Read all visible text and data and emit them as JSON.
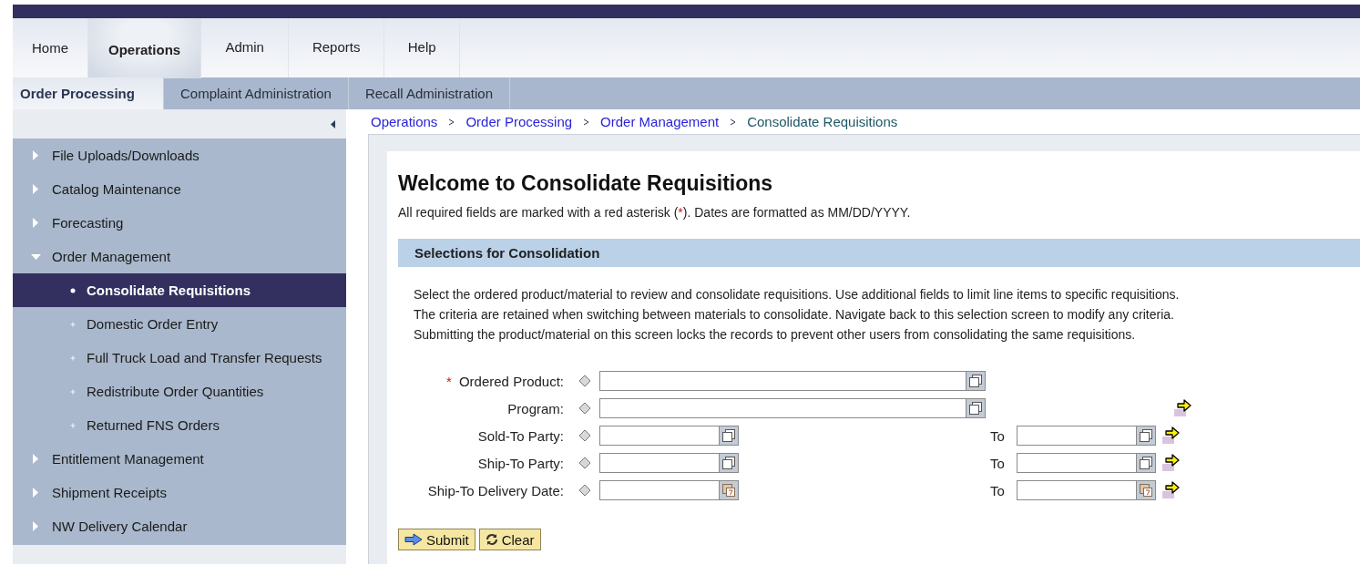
{
  "main_tabs": [
    {
      "label": "Home",
      "selected": false
    },
    {
      "label": "Operations",
      "selected": true
    },
    {
      "label": "Admin",
      "selected": false
    },
    {
      "label": "Reports",
      "selected": false
    },
    {
      "label": "Help",
      "selected": false
    }
  ],
  "sub_tabs": [
    {
      "label": "Order Processing",
      "selected": true
    },
    {
      "label": "Complaint Administration",
      "selected": false
    },
    {
      "label": "Recall Administration",
      "selected": false
    }
  ],
  "sidebar": {
    "items": [
      {
        "label": "File Uploads/Downloads",
        "expanded": false,
        "selected": false
      },
      {
        "label": "Catalog Maintenance",
        "expanded": false,
        "selected": false
      },
      {
        "label": "Forecasting",
        "expanded": false,
        "selected": false
      },
      {
        "label": "Order Management",
        "expanded": true,
        "selected": false,
        "children": [
          {
            "label": "Consolidate Requisitions",
            "selected": true
          },
          {
            "label": "Domestic Order Entry",
            "selected": false
          },
          {
            "label": "Full Truck Load and Transfer Requests",
            "selected": false
          },
          {
            "label": "Redistribute Order Quantities",
            "selected": false
          },
          {
            "label": "Returned FNS Orders",
            "selected": false
          }
        ]
      },
      {
        "label": "Entitlement Management",
        "expanded": false,
        "selected": false
      },
      {
        "label": "Shipment Receipts",
        "expanded": false,
        "selected": false
      },
      {
        "label": "NW Delivery Calendar",
        "expanded": false,
        "selected": false
      }
    ]
  },
  "breadcrumb": [
    {
      "label": "Operations",
      "kind": "link"
    },
    {
      "label": "Order Processing",
      "kind": "link"
    },
    {
      "label": "Order Management",
      "kind": "link"
    },
    {
      "label": "Consolidate Requisitions",
      "kind": "current"
    }
  ],
  "page": {
    "title": "Welcome to Consolidate Requisitions",
    "note_start": "All required fields are marked with a red asterisk (",
    "required_mark": "*",
    "note_end": "). Dates are formatted as MM/DD/YYYY."
  },
  "section": {
    "title": "Selections for Consolidation",
    "description": [
      "Select the ordered product/material to review and consolidate requisitions. Use additional fields to limit line items to specific requisitions.",
      "The criteria are retained when switching between materials to consolidate. Navigate back to this selection screen to modify any criteria.",
      "Submitting the product/material on this screen locks the records to prevent other users from consolidating the same requisitions."
    ]
  },
  "form": {
    "rows": [
      {
        "label": "Ordered Product:",
        "required": true,
        "kind": "lookup",
        "wide": true,
        "multiple": false
      },
      {
        "label": "Program:",
        "required": false,
        "kind": "lookup",
        "wide": true,
        "multiple": true
      },
      {
        "label": "Sold-To Party:",
        "required": false,
        "kind": "lookup",
        "wide": false,
        "to_label": "To",
        "multiple": true
      },
      {
        "label": "Ship-To Party:",
        "required": false,
        "kind": "lookup",
        "wide": false,
        "to_label": "To",
        "multiple": true
      },
      {
        "label": "Ship-To Delivery Date:",
        "required": false,
        "kind": "date",
        "wide": false,
        "to_label": "To",
        "multiple": true
      }
    ]
  },
  "buttons": [
    {
      "label": "Submit",
      "kind": "submit"
    },
    {
      "label": "Clear",
      "kind": "clear"
    }
  ]
}
